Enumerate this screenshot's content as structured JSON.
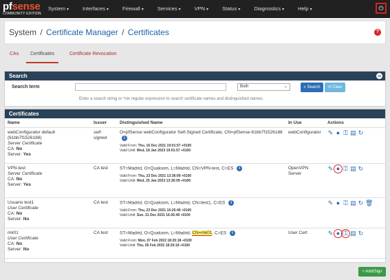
{
  "brand": {
    "name_pf": "pf",
    "name_sense": "sense",
    "edition": "COMMUNITY EDITION"
  },
  "nav": [
    "System",
    "Interfaces",
    "Firewall",
    "Services",
    "VPN",
    "Status",
    "Diagnostics",
    "Help"
  ],
  "breadcrumb": {
    "root": "System",
    "sep1": "/",
    "mid": "Certificate Manager",
    "sep2": "/",
    "current": "Certificates"
  },
  "tabs": [
    "CAs",
    "Certificates",
    "Certificate Revocation"
  ],
  "search": {
    "title": "Search",
    "label": "Search term",
    "input_value": "",
    "select_value": "Both",
    "search_btn": "Search",
    "clear_btn": "Clear",
    "help": "Enter a search string or *nix regular expression to search certificate names and distinguished names."
  },
  "certs": {
    "title": "Certificates",
    "headers": [
      "Name",
      "Issuer",
      "Distinguished Name",
      "In Use",
      "Actions"
    ],
    "rows": [
      {
        "name": "webConfigurator default (61bb7f1526188)",
        "type": "Server Certificate",
        "ca_label": "CA:",
        "ca": "No",
        "server_label": "Server:",
        "server": "Yes",
        "issuer": "self-signed",
        "dn": "O=pfSense webConfigurator Self-Signed Certificate, CN=pfSense-61bb7f1526188",
        "valid_from_label": "Valid From:",
        "valid_from": "Thu, 16 Dec 2021 19:01:57 +0100",
        "valid_until_label": "Valid Until:",
        "valid_until": "Wed, 18 Jan 2023 19:01:57 +0100",
        "in_use": "webConfigurator"
      },
      {
        "name": "VPN-test",
        "type": "Server Certificate",
        "ca_label": "CA:",
        "ca": "No",
        "server_label": "Server:",
        "server": "Yes",
        "issuer": "CA test",
        "dn": "ST=Madrid, O=Qualoom, L=Madrid, CN=VPN-test, C=ES",
        "valid_from_label": "Valid From:",
        "valid_from": "Thu, 23 Dec 2021 13:36:09 +0100",
        "valid_until_label": "Valid Until:",
        "valid_until": "Wed, 25 Jan 2023 13:36:09 +0100",
        "in_use": "OpenVPN Server"
      },
      {
        "name": "Usuario test1",
        "type": "User Certificate",
        "ca_label": "CA:",
        "ca": "No",
        "server_label": "Server:",
        "server": "No",
        "issuer": "CA test",
        "dn": "ST=Madrid, O=Qualoom, L=Madrid, CN=test1, C=ES",
        "valid_from_label": "Valid From:",
        "valid_from": "Thu, 23 Dec 2021 16:26:49 +0100",
        "valid_until_label": "Valid Until:",
        "valid_until": "Sun, 21 Dec 2031 16:26:49 +0100",
        "in_use": ""
      },
      {
        "name": "mk01",
        "type": "User Certificate",
        "ca_label": "CA:",
        "ca": "No",
        "server_label": "Server:",
        "server": "No",
        "issuer": "CA test",
        "dn_pre": "ST=Madrid, O=Qualoom, L=Madrid,",
        "dn_hl": "CN=mk01",
        "dn_post": ", C=ES",
        "valid_from_label": "Valid From:",
        "valid_from": "Mon, 07 Feb 2022 18:20:18 +0100",
        "valid_until_label": "Valid Until:",
        "valid_until": "Thu, 05 Feb 2032 18:20:18 +0100",
        "in_use": "User Cert"
      }
    ]
  },
  "add_button": "Add/Sign",
  "colors": {
    "navbar": "#212121",
    "panel_header": "#2a4258",
    "link": "#1a62a6",
    "accent_red": "#d9231f",
    "add_green": "#3a9a46"
  }
}
